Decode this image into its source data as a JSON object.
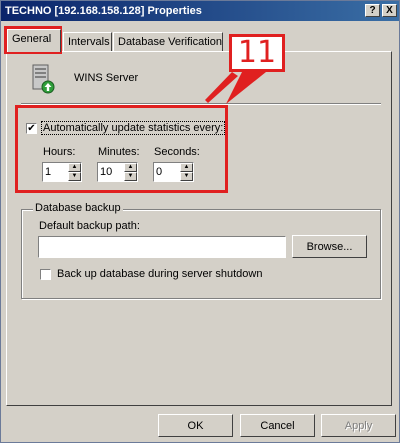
{
  "window": {
    "title": "TECHNO [192.168.158.128] Properties",
    "help_label": "?",
    "close_label": "X"
  },
  "tabs": [
    {
      "label": "General",
      "active": true
    },
    {
      "label": "Intervals",
      "active": false
    },
    {
      "label": "Database Verification",
      "active": false
    }
  ],
  "server": {
    "name": "WINS Server",
    "icon": "server-icon"
  },
  "statistics": {
    "auto_update_label": "Automatically update statistics every:",
    "auto_update_checked": true,
    "hours_label": "Hours:",
    "hours_value": "1",
    "minutes_label": "Minutes:",
    "minutes_value": "10",
    "seconds_label": "Seconds:",
    "seconds_value": "0"
  },
  "database_backup": {
    "group_label": "Database backup",
    "path_label": "Default backup path:",
    "path_value": "",
    "browse_label": "Browse...",
    "shutdown_label": "Back up database during server shutdown",
    "shutdown_checked": false
  },
  "buttons": {
    "ok": "OK",
    "cancel": "Cancel",
    "apply": "Apply"
  },
  "annotation": {
    "number": "11",
    "color": "#e02020"
  }
}
